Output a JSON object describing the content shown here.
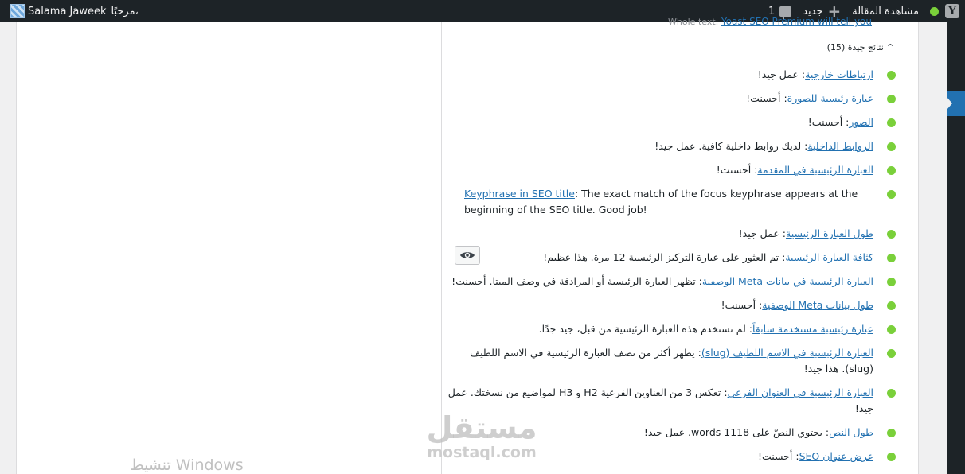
{
  "admin_bar": {
    "comments_count": "1",
    "new_label": "جديد",
    "view_post_label": "مشاهدة المقالة",
    "yoast_letter": "Y",
    "greeting": "مرحبًا،",
    "user_name": "Salama Jaweek"
  },
  "seo": {
    "cut_text_prefix": "Whole text:",
    "cut_text_link": "Yoast SEO Premium will tell you",
    "good_results_label": "نتائج جيدة (15)",
    "results": [
      {
        "link": "ارتباطات خارجية",
        "text": ": عمل جيد!"
      },
      {
        "link": "عبارة رئيسية للصورة",
        "text": ": أحسنت!"
      },
      {
        "link": "الصور",
        "text": ": أحسنت!"
      },
      {
        "link": "الروابط الداخلية",
        "text": ": لديك روابط داخلية كافية. عمل جيد!"
      },
      {
        "link": "العبارة الرئيسية في المقدمة",
        "text": ": أحسنت!"
      },
      {
        "link": "Keyphrase in SEO title",
        "text": ": The exact match of the focus keyphrase appears at the beginning of the SEO title. Good job!"
      },
      {
        "link": "طول العبارة الرئيسية",
        "text": ": عمل جيد!"
      },
      {
        "link": "كثافة العبارة الرئيسية",
        "text": ": تم العثور على عبارة التركيز الرئيسية 12 مرة. هذا عظيم!"
      },
      {
        "link": "العبارة الرئيسية في بيانات Meta الوصفية",
        "text": ": تظهر العبارة الرئيسية أو المرادفة في وصف الميتا. أحسنت!"
      },
      {
        "link": "طول بيانات Meta الوصفية",
        "text": ": أحسنت!"
      },
      {
        "link": "عبارة رئيسية مستخدمة سابقاً",
        "text": ": لم تستخدم هذه العبارة الرئيسية من قبل، جيد جدًا."
      },
      {
        "link": "العبارة الرئيسية في الاسم اللطيف (slug)",
        "text": ": يظهر أكثر من نصف العبارة الرئيسية في الاسم اللطيف (slug). هذا جيد!"
      },
      {
        "link": "العبارة الرئيسية في العنوان الفرعي",
        "text": ": تعكس 3 من العناوين الفرعية H2 و H3 لمواضيع من نسختك. عمل جيد!"
      },
      {
        "link": "طول النص",
        "text": ": يحتوي النصّ على 1118 words. عمل جيد!"
      },
      {
        "link": "عرض عنوان SEO",
        "text": ": أحسنت!"
      }
    ]
  },
  "watermarks": {
    "windows": "تنشيط Windows",
    "mostaql_ar": "مستقل",
    "mostaql_en": "mostaql.com"
  }
}
